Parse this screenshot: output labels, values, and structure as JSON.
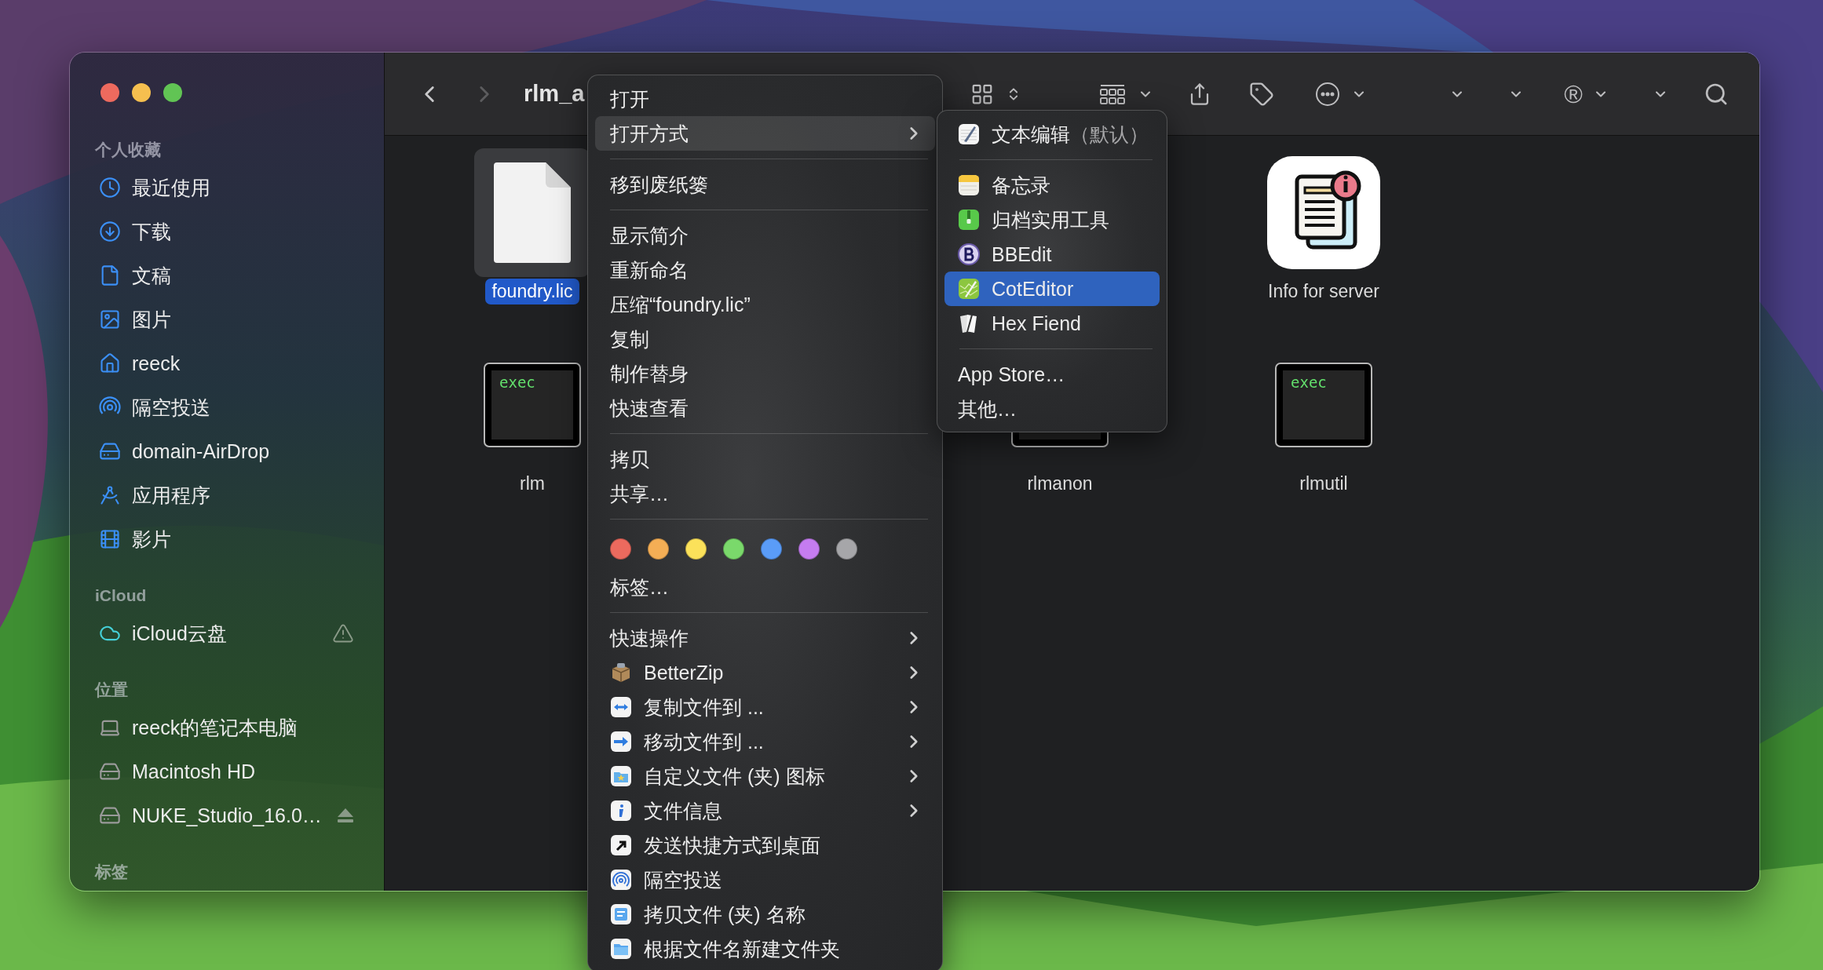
{
  "window": {
    "title": "rlm_a",
    "nav": [
      {
        "kind": "back",
        "disabled": false
      },
      {
        "kind": "forward",
        "disabled": true
      }
    ],
    "toolbar_glyph": "®"
  },
  "sidebar": {
    "sections": [
      {
        "heading": "个人收藏",
        "items": [
          {
            "label": "最近使用",
            "selected": false
          },
          {
            "label": "下载",
            "selected": false
          },
          {
            "label": "文稿",
            "selected": false
          },
          {
            "label": "图片",
            "selected": false
          },
          {
            "label": "reeck",
            "selected": false
          },
          {
            "label": "隔空投送",
            "selected": false
          },
          {
            "label": "domain-AirDrop",
            "selected": false
          },
          {
            "label": "应用程序",
            "selected": false
          },
          {
            "label": "影片",
            "selected": false
          }
        ]
      },
      {
        "heading": "iCloud",
        "items": [
          {
            "label": "iCloud云盘",
            "selected": false,
            "warning": true
          }
        ]
      },
      {
        "heading": "位置",
        "items": [
          {
            "label": "reeck的笔记本电脑",
            "selected": false,
            "ejectable": false
          },
          {
            "label": "Macintosh HD",
            "selected": false,
            "ejectable": false
          },
          {
            "label": "NUKE_Studio_16.0…",
            "selected": false,
            "ejectable": true
          }
        ]
      },
      {
        "heading": "标签"
      }
    ]
  },
  "files": [
    {
      "name": "foundry.lic",
      "kind": "document",
      "selected": true
    },
    {
      "name": "Info for server",
      "kind": "app-icon",
      "selected": false
    },
    {
      "name": "rlm",
      "kind": "exec",
      "badge": "exec",
      "selected": false
    },
    {
      "name": "rlmanon",
      "kind": "exec",
      "selected": false
    },
    {
      "name": "rlmutil",
      "kind": "exec",
      "badge": "exec",
      "selected": false
    }
  ],
  "context_menu": {
    "sections": [
      {
        "items": [
          {
            "label": "打开",
            "kind": "plain",
            "has_submenu": false,
            "selected": false
          },
          {
            "label": "打开方式",
            "kind": "plain",
            "has_submenu": true,
            "selected": true
          }
        ]
      },
      {
        "items": [
          {
            "label": "移到废纸篓",
            "kind": "plain",
            "has_submenu": false,
            "selected": false
          }
        ]
      },
      {
        "items": [
          {
            "label": "显示简介",
            "kind": "plain",
            "has_submenu": false,
            "selected": false
          },
          {
            "label": "重新命名",
            "kind": "plain",
            "has_submenu": false,
            "selected": false
          },
          {
            "label": "压缩“foundry.lic”",
            "kind": "plain",
            "has_submenu": false,
            "selected": false
          },
          {
            "label": "复制",
            "kind": "plain",
            "has_submenu": false,
            "selected": false
          },
          {
            "label": "制作替身",
            "kind": "plain",
            "has_submenu": false,
            "selected": false
          },
          {
            "label": "快速查看",
            "kind": "plain",
            "has_submenu": false,
            "selected": false
          }
        ]
      },
      {
        "items": [
          {
            "label": "拷贝",
            "kind": "plain",
            "has_submenu": false,
            "selected": false
          },
          {
            "label": "共享…",
            "kind": "plain",
            "has_submenu": false,
            "selected": false
          }
        ]
      },
      {
        "tag_colors": [
          {
            "color": "#ec6a5e"
          },
          {
            "color": "#f4ae55"
          },
          {
            "color": "#fbe15a"
          },
          {
            "color": "#7ad96b"
          },
          {
            "color": "#5a9cf8"
          },
          {
            "color": "#c57cf0"
          },
          {
            "color": "#a6a6a9"
          }
        ],
        "items": [
          {
            "label": "标签…",
            "kind": "plain",
            "has_submenu": false,
            "selected": false
          }
        ]
      },
      {
        "items": [
          {
            "label": "快速操作",
            "kind": "plain",
            "has_submenu": true,
            "selected": false
          },
          {
            "label": "BetterZip",
            "kind": "app",
            "has_submenu": true,
            "selected": false
          },
          {
            "label": "复制文件到 ...",
            "kind": "app",
            "has_submenu": true,
            "selected": false
          },
          {
            "label": "移动文件到 ...",
            "kind": "app",
            "has_submenu": true,
            "selected": false
          },
          {
            "label": "自定义文件 (夹) 图标",
            "kind": "app",
            "has_submenu": true,
            "selected": false
          },
          {
            "label": "文件信息",
            "kind": "app",
            "has_submenu": true,
            "selected": false
          },
          {
            "label": "发送快捷方式到桌面",
            "kind": "app",
            "has_submenu": false,
            "selected": false
          },
          {
            "label": "隔空投送",
            "kind": "app",
            "has_submenu": false,
            "selected": false
          },
          {
            "label": "拷贝文件 (夹) 名称",
            "kind": "app",
            "has_submenu": false,
            "selected": false
          },
          {
            "label": "根据文件名新建文件夹",
            "kind": "app",
            "has_submenu": false,
            "selected": false
          }
        ]
      }
    ]
  },
  "submenu": {
    "sections": [
      {
        "items": [
          {
            "label": "文本编辑",
            "suffix": "（默认）",
            "kind": "app",
            "selected": false
          }
        ]
      },
      {
        "items": [
          {
            "label": "备忘录",
            "kind": "app",
            "selected": false
          },
          {
            "label": "归档实用工具",
            "kind": "app",
            "selected": false
          },
          {
            "label": "BBEdit",
            "kind": "app",
            "selected": false
          },
          {
            "label": "CotEditor",
            "kind": "app",
            "selected": true
          },
          {
            "label": "Hex Fiend",
            "kind": "app",
            "selected": false
          }
        ]
      },
      {
        "items": [
          {
            "label": "App Store…",
            "kind": "plain",
            "selected": false
          },
          {
            "label": "其他…",
            "kind": "plain",
            "selected": false
          }
        ]
      }
    ]
  }
}
